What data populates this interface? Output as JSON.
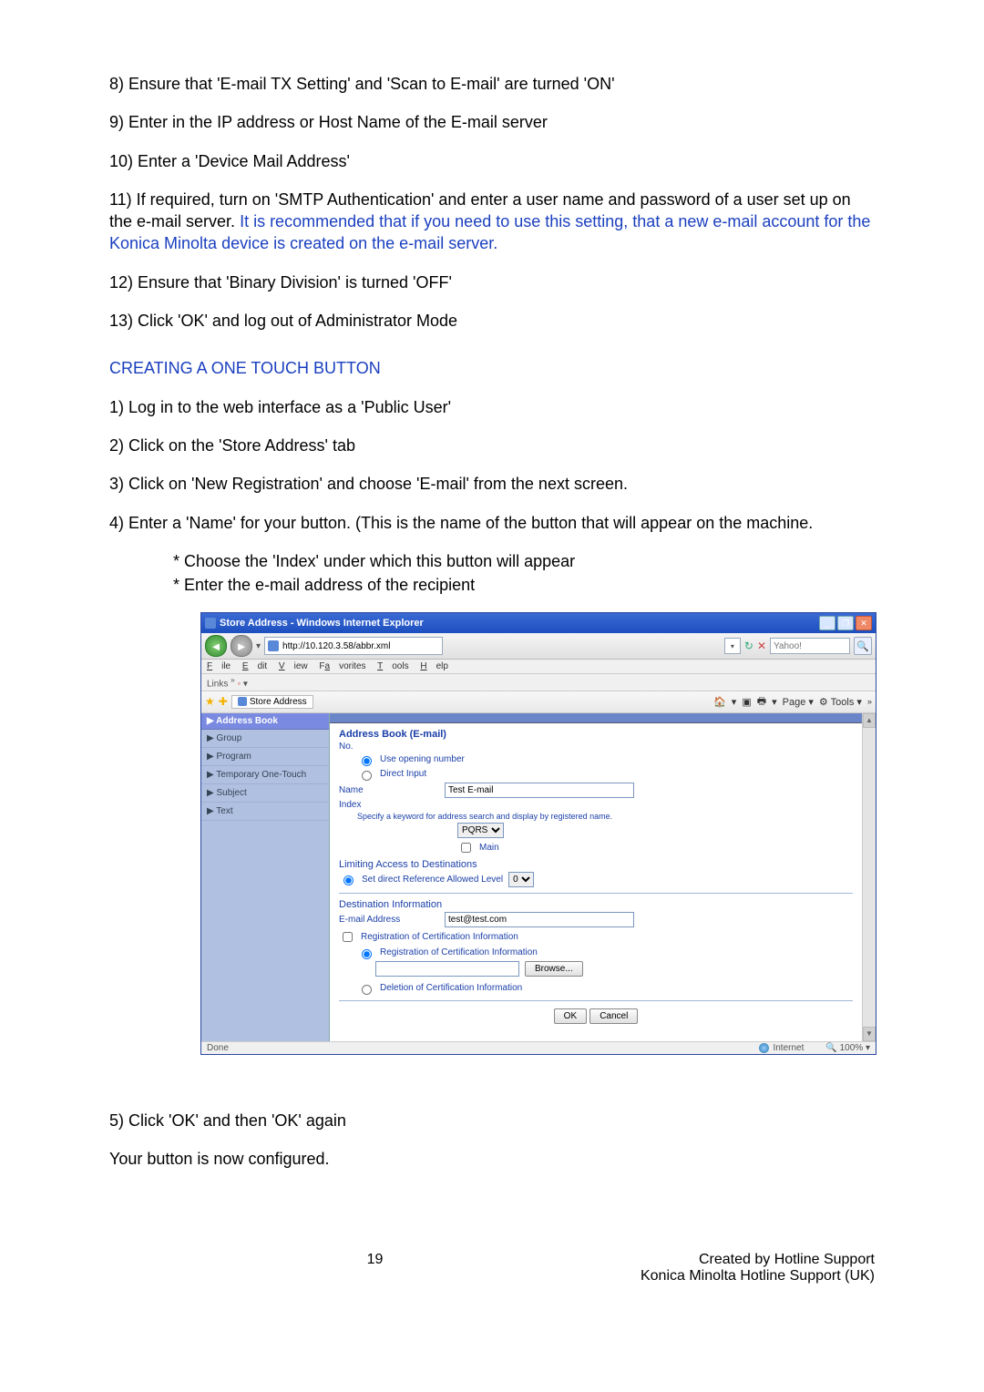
{
  "body": {
    "p1": "8) Ensure that 'E-mail TX Setting' and 'Scan to E-mail' are turned 'ON'",
    "p2": "9) Enter in the IP address or Host Name of the E-mail server",
    "p3": "10) Enter a 'Device Mail Address'",
    "p4a": "11) If required, turn on 'SMTP Authentication' and enter a user name and password of a user set up on the e-mail server.  ",
    "p4b": "It is recommended that if you need to use this setting, that a new e-mail account for the Konica Minolta device is created on the e-mail server.",
    "p5": "12) Ensure that 'Binary Division' is turned 'OFF'",
    "p6": "13) Click 'OK' and log out of Administrator Mode",
    "h1": "CREATING A ONE TOUCH BUTTON",
    "p7": "1) Log in to the web interface as a 'Public User'",
    "p8": "2) Click on the 'Store Address' tab",
    "p9": "3) Click on 'New Registration' and choose 'E-mail' from the next screen.",
    "p10": "4) Enter a 'Name' for your button.  (This is the name of the button that will appear on the machine.",
    "b1": "* Choose the 'Index' under which this button will appear",
    "b2": "* Enter the e-mail address of the recipient",
    "p11": "5) Click 'OK' and then 'OK' again",
    "p12": "Your button is now configured."
  },
  "footer": {
    "page": "19",
    "line1": "Created by Hotline Support",
    "line2": "Konica Minolta Hotline Support (UK)"
  },
  "ie": {
    "title": "Store Address - Windows Internet Explorer",
    "url": "http://10.120.3.58/abbr.xml",
    "search_placeholder": "Yahoo!",
    "menu": {
      "file": "File",
      "edit": "Edit",
      "view": "View",
      "favorites": "Favorites",
      "tools": "Tools",
      "help": "Help"
    },
    "links_label": "Links",
    "tab_label": "Store Address",
    "toolbar": {
      "home": "▾",
      "print": "Print",
      "page": "Page",
      "tools": "Tools"
    },
    "sidebar": {
      "header": "Address Book",
      "items": [
        "Group",
        "Program",
        "Temporary One-Touch",
        "Subject",
        "Text"
      ]
    },
    "form": {
      "heading": "Address Book (E-mail)",
      "no": "No.",
      "use_opening": "Use opening number",
      "direct_input": "Direct Input",
      "name_lbl": "Name",
      "name_val": "Test E-mail",
      "index_lbl": "Index",
      "index_hint": "Specify a keyword for address search and display by registered name.",
      "index_sel": "PQRS",
      "main_chk": "Main",
      "limit_hdr": "Limiting Access to Destinations",
      "ref_level": "Set direct Reference Allowed Level",
      "ref_level_val": "0",
      "dest_hdr": "Destination Information",
      "email_lbl": "E-mail Address",
      "email_val": "test@test.com",
      "reg_cert_chk": "Registration of Certification Information",
      "reg_cert_radio": "Registration of Certification Information",
      "browse": "Browse...",
      "del_cert": "Deletion of Certification Information",
      "ok": "OK",
      "cancel": "Cancel"
    },
    "status": {
      "done": "Done",
      "zone": "Internet",
      "zoom": "100%"
    }
  }
}
